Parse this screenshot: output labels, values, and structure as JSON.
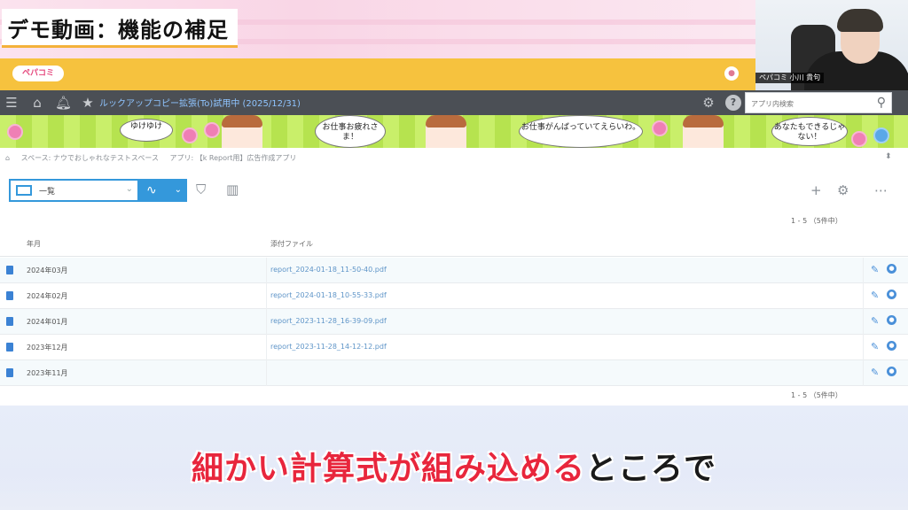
{
  "video": {
    "title": "デモ動画：機能の補足",
    "subtitle_highlight": "細かい計算式が組み込める",
    "subtitle_rest": "ところで",
    "presenter_name": "ペパコミ 小川 貴句"
  },
  "header": {
    "logo_text": "ペパコミ",
    "app_title": "ルックアップコピー拡張(To)試用中 (2025/12/31)",
    "search_placeholder": "アプリ内検索"
  },
  "banner": {
    "bubbles": [
      "お仕事お疲れさま！",
      "お仕事がんばっていてえらいわ。",
      "あなたもできるじゃない！",
      "ゆけゆけ"
    ]
  },
  "breadcrumb": {
    "items": [
      "スペース: ナウでおしゃれなテストスペース",
      "アプリ: 【k Report用】広告作成アプリ"
    ]
  },
  "toolbar": {
    "view_label": "一覧",
    "record_count_top": "1 - 5 （5件中）",
    "record_count_bottom": "1 - 5 （5件中）"
  },
  "table": {
    "columns": [
      "年月",
      "添付ファイル"
    ],
    "rows": [
      {
        "ym": "2024年03月",
        "file": "report_2024-01-18_11-50-40.pdf"
      },
      {
        "ym": "2024年02月",
        "file": "report_2024-01-18_10-55-33.pdf"
      },
      {
        "ym": "2024年01月",
        "file": "report_2023-11-28_16-39-09.pdf"
      },
      {
        "ym": "2023年12月",
        "file": "report_2023-11-28_14-12-12.pdf"
      },
      {
        "ym": "2023年11月",
        "file": ""
      }
    ]
  },
  "colors": {
    "accent_blue": "#3498db",
    "nav_dark": "#4b4f55",
    "header_yellow": "#f6c23e",
    "subtitle_red": "#e8263c"
  },
  "icons": [
    "menu-icon",
    "home-icon",
    "bell-icon",
    "star-icon",
    "gear-icon",
    "help-icon",
    "search-icon",
    "table-view-icon",
    "graph-icon",
    "filter-icon",
    "bar-chart-icon",
    "plus-icon",
    "settings-icon",
    "more-icon",
    "file-icon",
    "edit-icon"
  ]
}
